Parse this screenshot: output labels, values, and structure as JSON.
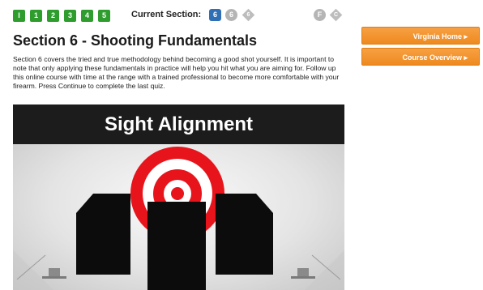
{
  "nav": {
    "section_buttons": [
      "I",
      "1",
      "2",
      "3",
      "4",
      "5"
    ],
    "current_label": "Current Section:",
    "current_badges": [
      {
        "label": "6",
        "shape": "square",
        "color": "#2f6fb5"
      },
      {
        "label": "6",
        "shape": "circle",
        "color": "#b5b5b5"
      },
      {
        "label": "6",
        "shape": "diamond",
        "color": "#bdbdbd"
      }
    ],
    "final_badges": [
      {
        "label": "F",
        "shape": "circle",
        "color": "#b5b5b5"
      },
      {
        "label": "C",
        "shape": "diamond",
        "color": "#bdbdbd"
      }
    ],
    "section_button_color": "#2e9d2e"
  },
  "content": {
    "title": "Section 6 - Shooting Fundamentals",
    "description": "Section 6 covers the tried and true methodology behind becoming a good shot yourself.  It is important to note that only applying these fundamentals in practice will help you hit what you are aiming for. Follow up this online course with time at the range with a trained professional to become more comfortable with your firearm.  Press Continue to complete the last quiz."
  },
  "sidebar": {
    "buttons": [
      "Virginia Home ▸",
      "Course Overview ▸"
    ],
    "button_color": "#f39a33"
  },
  "video": {
    "heading": "Sight Alignment",
    "target_colors": {
      "red": "#e8141c",
      "white": "#ffffff",
      "sight": "#0c0c0c"
    }
  }
}
